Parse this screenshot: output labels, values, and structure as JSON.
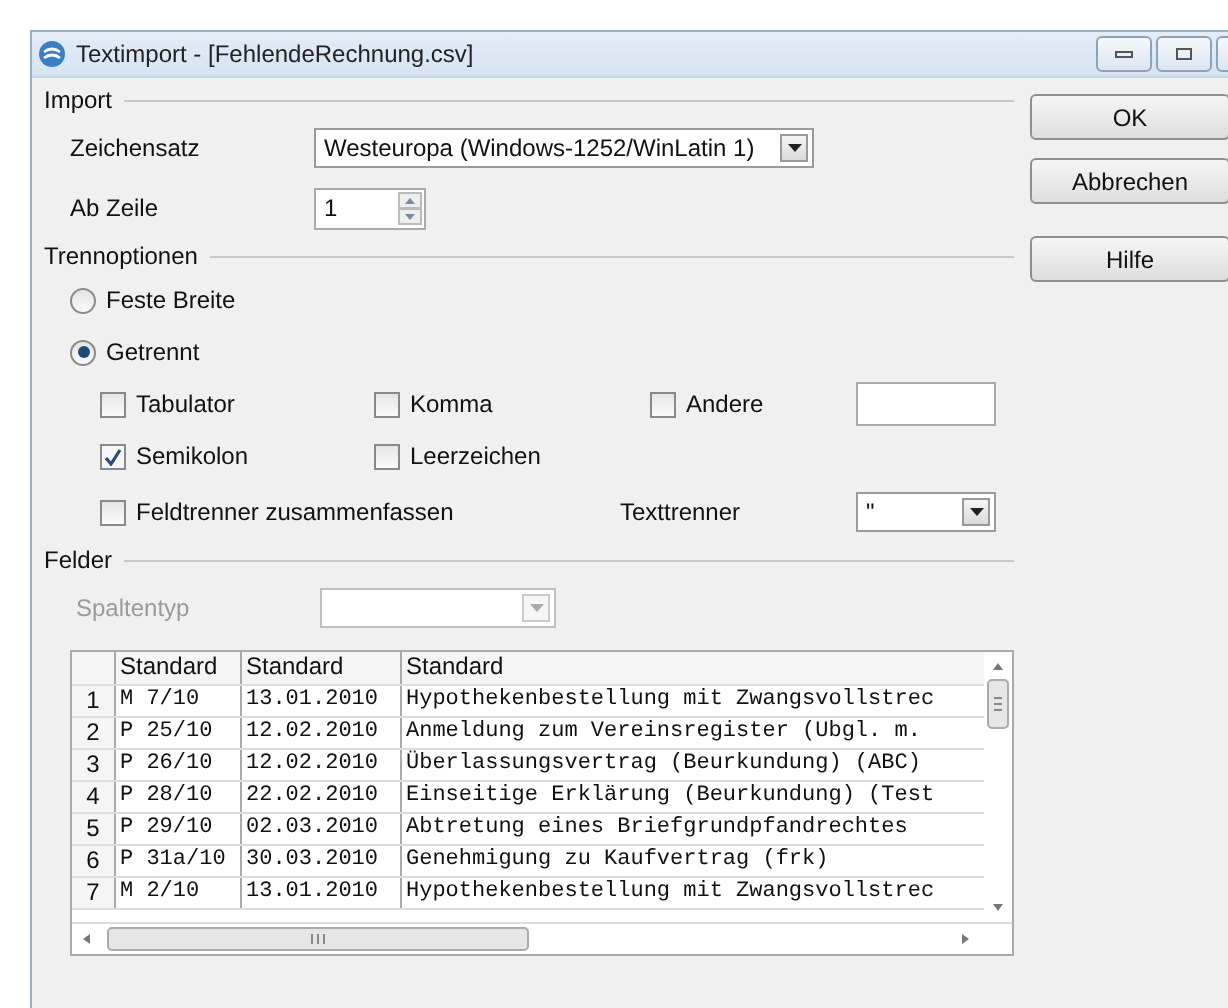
{
  "window": {
    "title": "Textimport - [FehlendeRechnung.csv]"
  },
  "import": {
    "heading": "Import",
    "charset": {
      "label": "Zeichensatz",
      "value": "Westeuropa (Windows-1252/WinLatin 1)"
    },
    "from_row": {
      "label": "Ab Zeile",
      "value": "1"
    }
  },
  "buttons": [
    "OK",
    "Abbrechen",
    "Hilfe"
  ],
  "separator_options": {
    "heading": "Trennoptionen",
    "modes": [
      {
        "label": "Feste Breite",
        "selected": false
      },
      {
        "label": "Getrennt",
        "selected": true
      }
    ],
    "separators": [
      {
        "label": "Tabulator",
        "checked": false
      },
      {
        "label": "Komma",
        "checked": false
      },
      {
        "label": "Andere",
        "checked": false
      },
      {
        "label": "Semikolon",
        "checked": true
      },
      {
        "label": "Leerzeichen",
        "checked": false
      }
    ],
    "merge": {
      "label": "Feldtrenner zusammenfassen",
      "checked": false
    },
    "text_delimiter": {
      "label": "Texttrenner",
      "value": "\""
    }
  },
  "fields": {
    "heading": "Felder",
    "column_type": {
      "label": "Spaltentyp",
      "disabled": true
    },
    "table": {
      "columns": [
        "Standard",
        "Standard",
        "Standard"
      ],
      "rows": [
        {
          "number": "1",
          "cells": [
            "M 7/10",
            "13.01.2010",
            "Hypothekenbestellung mit Zwangsvollstrec"
          ]
        },
        {
          "number": "2",
          "cells": [
            "P 25/10",
            "12.02.2010",
            "Anmeldung zum Vereinsregister (Ubgl. m."
          ]
        },
        {
          "number": "3",
          "cells": [
            "P 26/10",
            "12.02.2010",
            "Überlassungsvertrag (Beurkundung) (ABC)"
          ]
        },
        {
          "number": "4",
          "cells": [
            "P 28/10",
            "22.02.2010",
            "Einseitige Erklärung (Beurkundung) (Test"
          ]
        },
        {
          "number": "5",
          "cells": [
            "P 29/10",
            "02.03.2010",
            "Abtretung eines Briefgrundpfandrechtes"
          ]
        },
        {
          "number": "6",
          "cells": [
            "P 31a/10",
            "30.03.2010",
            "Genehmigung zu Kaufvertrag (frk)"
          ]
        },
        {
          "number": "7",
          "cells": [
            "M 2/10",
            "13.01.2010",
            "Hypothekenbestellung mit Zwangsvollstrec"
          ]
        }
      ]
    }
  }
}
